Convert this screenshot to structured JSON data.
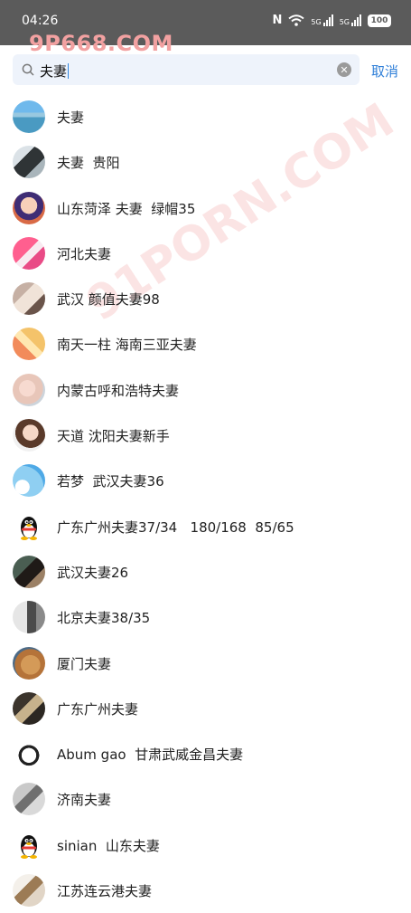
{
  "status_bar": {
    "time": "04:26",
    "nfc": "N",
    "sim1": "5G",
    "sim2": "5G",
    "battery": "100"
  },
  "watermarks": [
    "9P668.COM",
    "91PORN.COM"
  ],
  "search": {
    "query": "夫妻",
    "cancel_label": "取消"
  },
  "results": [
    {
      "name": "夫妻",
      "avatar": "landscape-photo"
    },
    {
      "name": "夫妻  贵阳",
      "avatar": "photo"
    },
    {
      "name": "山东菏泽 夫妻  绿帽35",
      "avatar": "cartoon"
    },
    {
      "name": "河北夫妻",
      "avatar": "photo"
    },
    {
      "name": "武汉 颜值夫妻98",
      "avatar": "photo"
    },
    {
      "name": "南天一柱 海南三亚夫妻",
      "avatar": "photo"
    },
    {
      "name": "内蒙古呼和浩特夫妻",
      "avatar": "photo"
    },
    {
      "name": "天道 沈阳夫妻新手",
      "avatar": "photo"
    },
    {
      "name": "若梦  武汉夫妻36",
      "avatar": "photo"
    },
    {
      "name": "广东广州夫妻37/34   180/168  85/65",
      "avatar": "qq-penguin"
    },
    {
      "name": "武汉夫妻26",
      "avatar": "photo"
    },
    {
      "name": "北京夫妻38/35",
      "avatar": "photo"
    },
    {
      "name": "厦门夫妻",
      "avatar": "dog-photo"
    },
    {
      "name": "广东广州夫妻",
      "avatar": "photo"
    },
    {
      "name": "Abum gao  甘肃武威金昌夫妻",
      "avatar": "photo"
    },
    {
      "name": "济南夫妻",
      "avatar": "photo"
    },
    {
      "name": "sinian  山东夫妻",
      "avatar": "qq-penguin"
    },
    {
      "name": "江苏连云港夫妻",
      "avatar": "photo"
    }
  ]
}
